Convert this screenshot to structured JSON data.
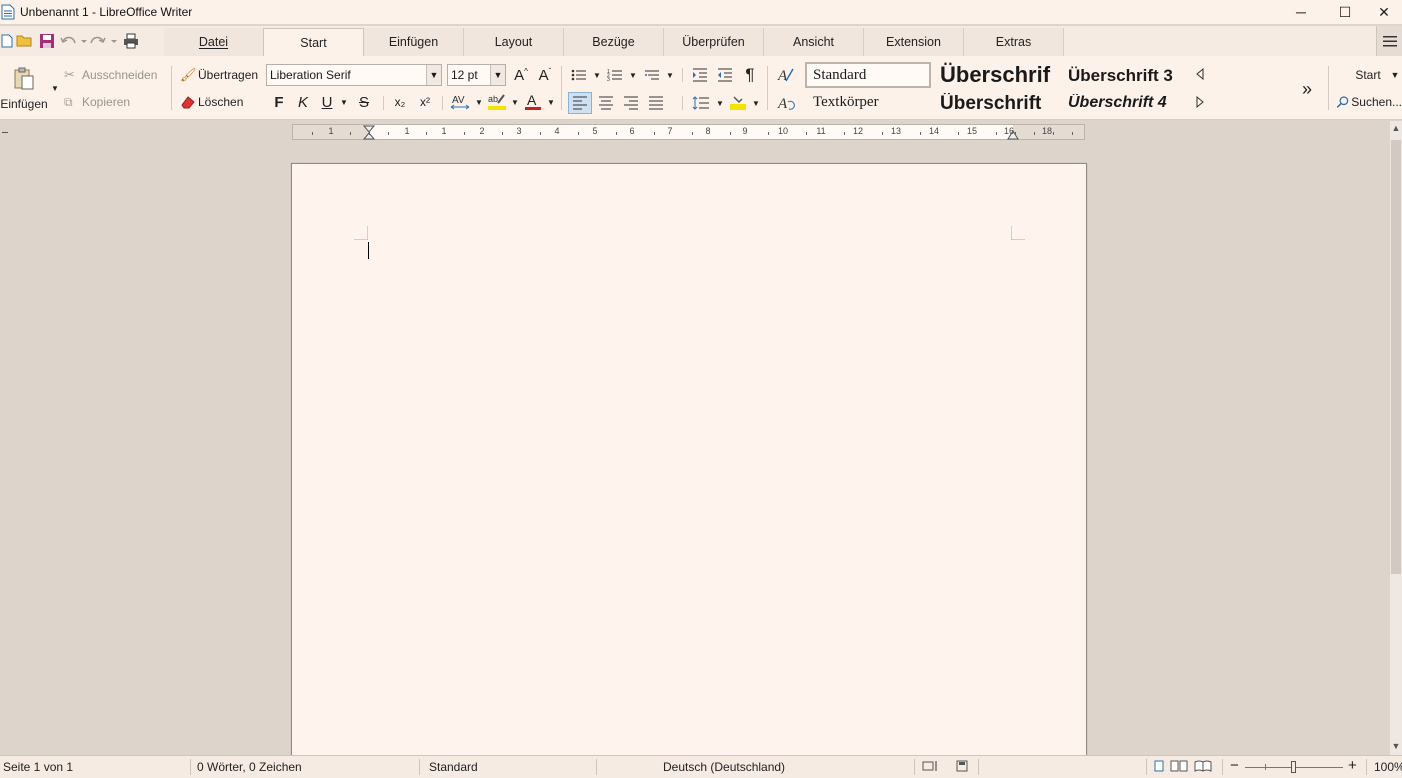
{
  "window": {
    "title": "Unbenannt 1 - LibreOffice Writer",
    "minimize": "─",
    "maximize": "☐",
    "close": "✕"
  },
  "tabs": [
    "Datei",
    "Start",
    "Einfügen",
    "Layout",
    "Bezüge",
    "Überprüfen",
    "Ansicht",
    "Extension",
    "Extras"
  ],
  "active_tab": "Start",
  "clipboard": {
    "paste_label": "Einfügen",
    "cut_label": "Ausschneiden",
    "copy_label": "Kopieren",
    "clone_label": "Übertragen",
    "clear_label": "Löschen"
  },
  "font": {
    "name": "Liberation Serif",
    "size": "12 pt",
    "bold": "F",
    "italic": "K",
    "underline": "U",
    "strike": "S",
    "sub": "x₂",
    "sup": "x²"
  },
  "styles": {
    "standard": "Standard",
    "body": "Textkörper",
    "h1": "Überschrif",
    "h2": "Überschrift",
    "h3": "Überschrift 3",
    "h4": "Überschrift 4"
  },
  "right_panel": {
    "start_label": "Start",
    "search_label": "Suchen..."
  },
  "ruler": {
    "numbers": [
      "1",
      "1",
      "1",
      "2",
      "3",
      "4",
      "5",
      "6",
      "7",
      "8",
      "9",
      "10",
      "11",
      "12",
      "13",
      "14",
      "15",
      "16",
      "18"
    ]
  },
  "statusbar": {
    "page": "Seite 1 von 1",
    "words": "0 Wörter, 0 Zeichen",
    "style": "Standard",
    "language": "Deutsch (Deutschland)",
    "zoom": "100%"
  },
  "colors": {
    "accent_highlight": "#f3e400",
    "font_color": "#c9211e",
    "save_icon": "#a0307a"
  }
}
